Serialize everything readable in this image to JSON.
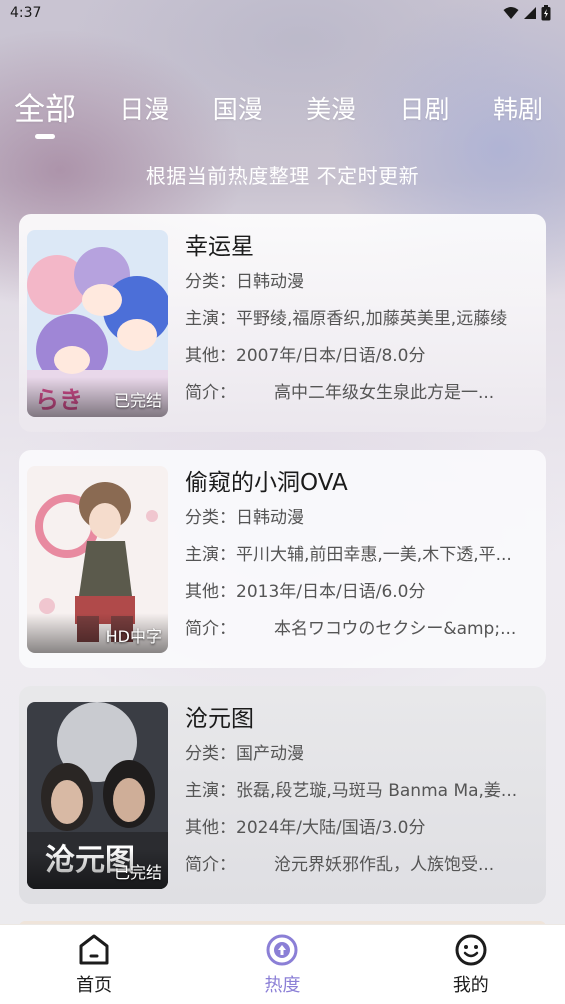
{
  "status_bar": {
    "time": "4:37"
  },
  "tabs": [
    {
      "label": "全部",
      "active": true
    },
    {
      "label": "日漫",
      "active": false
    },
    {
      "label": "国漫",
      "active": false
    },
    {
      "label": "美漫",
      "active": false
    },
    {
      "label": "日剧",
      "active": false
    },
    {
      "label": "韩剧",
      "active": false
    }
  ],
  "subtitle": "根据当前热度整理 不定时更新",
  "labels": {
    "category": "分类：",
    "cast": "主演：",
    "other": "其他：",
    "intro": "简介："
  },
  "items": [
    {
      "title": "幸运星",
      "category": "日韩动漫",
      "cast": "平野绫,福原香织,加藤英美里,远藤绫",
      "other": "2007年/日本/日语/8.0分",
      "intro": "高中二年级女生泉此方是一...",
      "tag": "已完结"
    },
    {
      "title": "偷窥的小洞OVA",
      "category": "日韩动漫",
      "cast": "平川大辅,前田幸惠,一美,木下透,平...",
      "other": "2013年/日本/日语/6.0分",
      "intro": "本名ワコウのセクシー&amp;...",
      "tag": "HD中字"
    },
    {
      "title": "沧元图",
      "category": "国产动漫",
      "cast": "张磊,段艺璇,马斑马 Banma Ma,姜...",
      "other": "2024年/大陆/国语/3.0分",
      "intro": "沧元界妖邪作乱，人族饱受...",
      "tag": "已完结"
    }
  ],
  "bottom_nav": [
    {
      "label": "首页",
      "icon": "home-icon",
      "active": false
    },
    {
      "label": "热度",
      "icon": "trending-icon",
      "active": true
    },
    {
      "label": "我的",
      "icon": "smiley-icon",
      "active": false
    }
  ],
  "colors": {
    "accent": "#8b7fd6",
    "text": "#1b1b1b",
    "secondary": "#555555"
  }
}
